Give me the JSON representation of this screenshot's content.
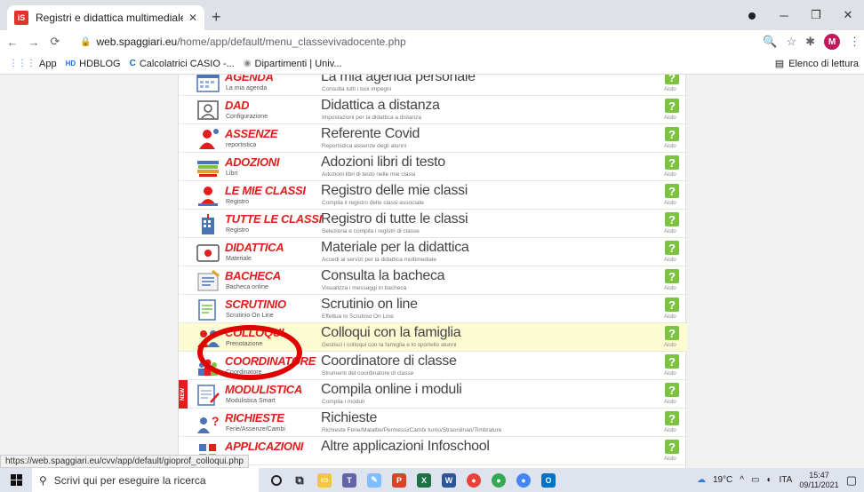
{
  "browser": {
    "tab_title": "Registri e didattica multimediale",
    "tab_favicon": "iS",
    "url_host": "web.spaggiari.eu",
    "url_path": "/home/app/default/menu_classevivadocente.php",
    "avatar": "M",
    "bookmarks": [
      {
        "label": "App",
        "icon": "apps-grid-icon"
      },
      {
        "label": "HDBLOG",
        "icon": "hd-icon"
      },
      {
        "label": "Calcolatrici CASIO -...",
        "icon": "casio-icon"
      },
      {
        "label": "Dipartimenti | Univ...",
        "icon": "globe-icon"
      }
    ],
    "reading_list": "Elenco di lettura",
    "status_url": "https://web.spaggiari.eu/cvv/app/default/gioprof_colloqui.php"
  },
  "menu": {
    "help_label": "Aiuto",
    "help_glyph": "?",
    "items": [
      {
        "name": "AGENDA",
        "sub": "La mia agenda",
        "desc": "La mia agenda personale",
        "desc_sub": "Consulta tutti i tuoi impegni",
        "icon": "calendar-icon"
      },
      {
        "name": "DAD",
        "sub": "Configurazione",
        "desc": "Didattica a distanza",
        "desc_sub": "Impostazioni per la didattica a distanza",
        "icon": "user-card-icon"
      },
      {
        "name": "ASSENZE",
        "sub": "reportistica",
        "desc": "Referente Covid",
        "desc_sub": "Reportistica assenze degli alunni",
        "icon": "person-icon"
      },
      {
        "name": "ADOZIONI",
        "sub": "Libri",
        "desc": "Adozioni libri di testo",
        "desc_sub": "Adozioni libri di testo nelle mie classi",
        "icon": "books-icon"
      },
      {
        "name": "LE MIE CLASSI",
        "sub": "Registro",
        "desc": "Registro delle mie classi",
        "desc_sub": "Compila il registro delle classi associate",
        "icon": "teacher-icon"
      },
      {
        "name": "TUTTE LE CLASSI",
        "sub": "Registro",
        "desc": "Registro di tutte le classi",
        "desc_sub": "Seleziona e compila i registri di classe",
        "icon": "building-icon"
      },
      {
        "name": "DIDATTICA",
        "sub": "Materiale",
        "desc": "Materiale per la didattica",
        "desc_sub": "Accedi ai servizi per la didattica multimediale",
        "icon": "record-icon"
      },
      {
        "name": "BACHECA",
        "sub": "Bacheca online",
        "desc": "Consulta la bacheca",
        "desc_sub": "Visualizza i messaggi in bacheca",
        "icon": "notice-board-icon"
      },
      {
        "name": "SCRUTINIO",
        "sub": "Scrutinio On Line",
        "desc": "Scrutinio on line",
        "desc_sub": "Effettua lo Scrutinio On Line",
        "icon": "report-card-icon"
      },
      {
        "name": "COLLOQUI",
        "sub": "Prenotazione",
        "desc": "Colloqui con la famiglia",
        "desc_sub": "Gestisci i colloqui con la famiglia e lo sportello alunni",
        "icon": "meeting-icon"
      },
      {
        "name": "COORDINATORE",
        "sub": "Coordinatore",
        "desc": "Coordinatore di classe",
        "desc_sub": "Strumenti del coordinatore di classe",
        "icon": "group-icon"
      },
      {
        "name": "MODULISTICA",
        "sub": "Modulistica Smart",
        "desc": "Compila online i moduli",
        "desc_sub": "Compila i moduli",
        "icon": "form-icon",
        "badge": "NEW"
      },
      {
        "name": "RICHIESTE",
        "sub": "Ferie/Assenze/Cambi",
        "desc": "Richieste",
        "desc_sub": "Richieste Ferie/Malattie/Permessi/Cambi turno/Straordinari/Timbrature",
        "icon": "request-icon"
      },
      {
        "name": "APPLICAZIONI",
        "sub": "",
        "desc": "Altre applicazioni Infoschool",
        "desc_sub": "",
        "icon": "apps-icon"
      }
    ]
  },
  "taskbar": {
    "search_placeholder": "Scrivi qui per eseguire la ricerca",
    "temperature": "19°C",
    "language": "ITA",
    "time": "15:47",
    "date": "09/11/2021"
  },
  "colors": {
    "accent_red": "#e01e1e",
    "help_green": "#7cc33f",
    "highlight_row": "#fdfbd2"
  }
}
